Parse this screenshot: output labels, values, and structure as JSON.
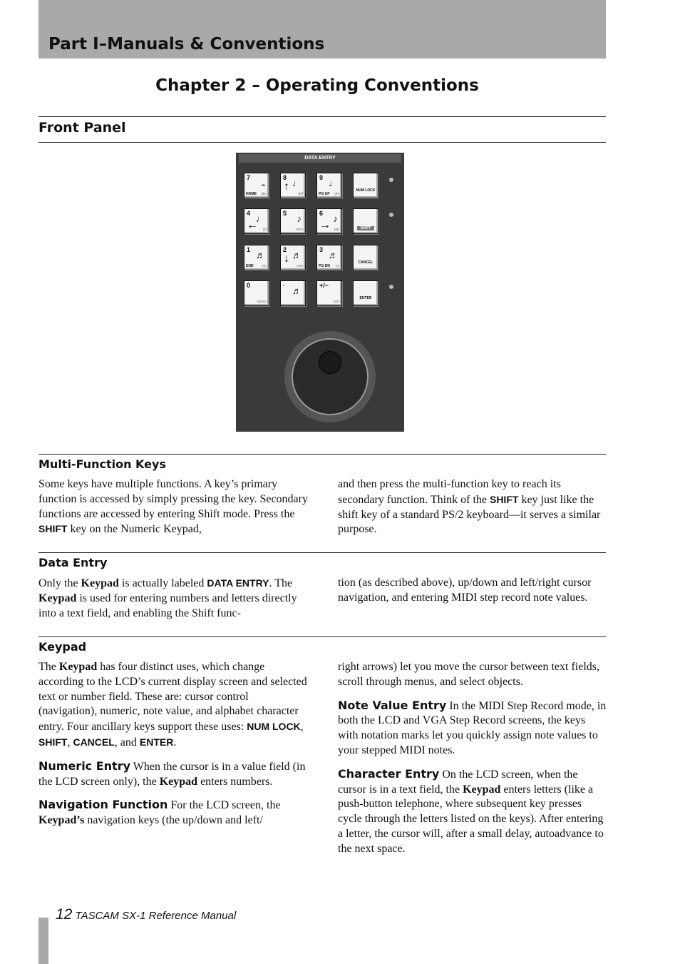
{
  "header": {
    "part_title": "Part I–Manuals & Conventions",
    "chapter_title": "Chapter 2 – Operating Conventions",
    "section_title": "Front Panel"
  },
  "panel": {
    "title": "DATA ENTRY",
    "keys": [
      {
        "num": "7",
        "left": "HOME",
        "sub": "abc",
        "note": "𝅝"
      },
      {
        "num": "8",
        "sub": "def",
        "note": "♩",
        "arrow": "↑"
      },
      {
        "num": "9",
        "left": "PG UP",
        "sub": "ghi",
        "note": "♩"
      },
      {
        "center": "NUM LOCK"
      },
      {
        "num": "4",
        "sub": "jkl",
        "note": "♩",
        "arrow": "←"
      },
      {
        "num": "5",
        "sub": "mno",
        "note": "♪"
      },
      {
        "num": "6",
        "sub": "pqr",
        "note": "♪",
        "arrow": "→"
      },
      {
        "center": "SHIFT",
        "shift": true
      },
      {
        "num": "1",
        "left": "END",
        "sub": "stu",
        "note": "♬"
      },
      {
        "num": "2",
        "sub": "vwx",
        "note": "♬",
        "arrow": "↓"
      },
      {
        "num": "3",
        "left": "PG DN",
        "sub": "yz",
        "note": "♬"
      },
      {
        "center": "CANCEL"
      },
      {
        "num": "0",
        "sub": "space"
      },
      {
        "num": "·",
        "note": "♬"
      },
      {
        "num": "+/−",
        "sub": "rest"
      },
      {
        "center": "ENTER"
      }
    ]
  },
  "sections": [
    {
      "title": "Multi-Function Keys",
      "left": [
        [
          {
            "t": "Some keys have multiple functions. A key’s primary function is accessed by simply pressing the key. Secondary functions are accessed by entering Shift mode. Press the "
          },
          {
            "t": "SHIFT",
            "s": "k"
          },
          {
            "t": " key on the Numeric Keypad,"
          }
        ]
      ],
      "right": [
        [
          {
            "t": "and then press the multi-function key to reach its secondary function. Think of the "
          },
          {
            "t": "SHIFT",
            "s": "k"
          },
          {
            "t": " key just like the shift key of a standard PS/2 keyboard—it serves a similar purpose."
          }
        ]
      ]
    },
    {
      "title": "Data Entry",
      "left": [
        [
          {
            "t": "Only the "
          },
          {
            "t": "Keypad",
            "s": "b"
          },
          {
            "t": " is actually labeled "
          },
          {
            "t": "DATA ENTRY",
            "s": "k"
          },
          {
            "t": ". The "
          },
          {
            "t": "Keypad",
            "s": "b"
          },
          {
            "t": " is used for entering numbers and letters directly into a text field, and enabling the Shift func-"
          }
        ]
      ],
      "right": [
        [
          {
            "t": "tion (as described above), up/down and left/right cursor navigation, and entering MIDI step record note values."
          }
        ]
      ]
    },
    {
      "title": "Keypad",
      "left": [
        [
          {
            "t": "The "
          },
          {
            "t": "Keypad",
            "s": "b"
          },
          {
            "t": " has four distinct uses, which change according to the LCD’s current display screen and selected text or number field. These are: cursor control (navigation), numeric, note value, and alphabet character entry. Four ancillary keys support these uses: "
          },
          {
            "t": "NUM LOCK",
            "s": "k"
          },
          {
            "t": ", "
          },
          {
            "t": "SHIFT",
            "s": "k"
          },
          {
            "t": ", "
          },
          {
            "t": "CANCEL",
            "s": "k"
          },
          {
            "t": ", and "
          },
          {
            "t": "ENTER",
            "s": "k"
          },
          {
            "t": "."
          }
        ],
        [
          {
            "t": "Numeric Entry",
            "s": "rh"
          },
          {
            "t": " When the cursor is in a value field (in the LCD screen only), the "
          },
          {
            "t": "Keypad",
            "s": "b"
          },
          {
            "t": " enters numbers."
          }
        ],
        [
          {
            "t": "Navigation Function",
            "s": "rh"
          },
          {
            "t": " For the LCD screen, the "
          },
          {
            "t": "Keypad’s",
            "s": "b"
          },
          {
            "t": " navigation keys (the up/down and left/"
          }
        ]
      ],
      "right": [
        [
          {
            "t": "right arrows) let you move the cursor between text fields, scroll through menus, and select objects."
          }
        ],
        [
          {
            "t": "Note Value Entry",
            "s": "rh"
          },
          {
            "t": " In the MIDI Step Record mode, in both the LCD and VGA Step Record screens, the keys with notation marks let you quickly assign note values to your stepped MIDI notes."
          }
        ],
        [
          {
            "t": "Character Entry",
            "s": "rh"
          },
          {
            "t": " On the LCD screen, when the cursor is in a text field, the "
          },
          {
            "t": "Keypad",
            "s": "b"
          },
          {
            "t": " enters letters (like a push-button telephone, where subsequent key presses cycle through the letters listed on the keys). After entering a letter, the cursor will, after a small delay, autoadvance to the next space."
          }
        ]
      ]
    }
  ],
  "footer": {
    "page_number": "12",
    "manual": "TASCAM SX-1 Reference Manual"
  }
}
